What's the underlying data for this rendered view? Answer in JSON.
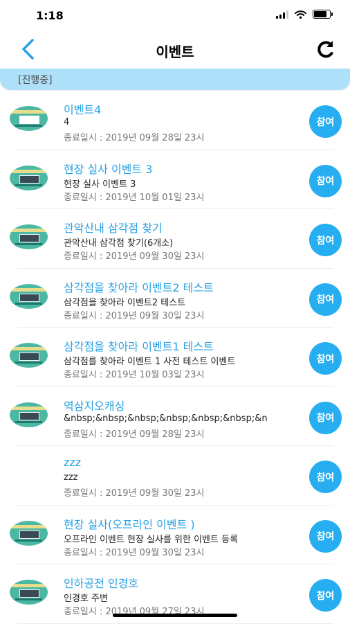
{
  "status_bar": {
    "time": "1:18"
  },
  "nav": {
    "title": "이벤트"
  },
  "section": {
    "label": "[진행중]"
  },
  "events": [
    {
      "title": "이벤트4",
      "desc": "4",
      "end": "종료일시 : 2019년 09월 28일 23시",
      "button": "참여",
      "thumb": "white"
    },
    {
      "title": "현장 실사 이벤트 3",
      "desc": "현장 실사 이벤트 3",
      "end": "종료일시 : 2019년 10월 01일 23시",
      "button": "참여",
      "thumb": "photo"
    },
    {
      "title": "관악산내 삼각점 찾기",
      "desc": "관악산내 삼각점 찾기(6개소)",
      "end": "종료일시 : 2019년 09월 30일 23시",
      "button": "참여",
      "thumb": "photo"
    },
    {
      "title": "삼각점을 찾아라 이벤트2 테스트",
      "desc": "삼각점을 찾아라 이벤트2 테스트",
      "end": "종료일시 : 2019년 09월 30일 23시",
      "button": "참여",
      "thumb": "photo"
    },
    {
      "title": "삼각점을 찾아라 이벤트1 테스트",
      "desc": "삼각점를 찾아라 이벤트 1 사전 테스트 이벤트",
      "end": "종료일시 : 2019년 10월 03일 23시",
      "button": "참여",
      "thumb": "photo"
    },
    {
      "title": "역삼지오캐싱",
      "desc": "&nbsp;&nbsp;&nbsp;&nbsp;&nbsp;&nbsp;&n",
      "end": "종료일시 : 2019년 09월 28일 23시",
      "button": "참여",
      "thumb": "photo"
    },
    {
      "title": "zzz",
      "desc": "zzz",
      "end": "종료일시 : 2019년 09월 30일 23시",
      "button": "참여",
      "thumb": "none"
    },
    {
      "title": "현장 실사(오프라인 이벤트 )",
      "desc": "오프라인 이벤트 현장 실사를 위한 이벤트 등록",
      "end": "종료일시 : 2019년 09월 30일 23시",
      "button": "참여",
      "thumb": "photo"
    },
    {
      "title": "인하공전 인경호",
      "desc": "인경호 주변",
      "end": "종료일시 : 2019년 09월 27일 23시",
      "button": "참여",
      "thumb": "photo"
    }
  ],
  "colors": {
    "accent": "#27a2e4",
    "button": "#26aef0",
    "section_bg": "#aee0f9"
  },
  "icons": {
    "back": "chevron-left-icon",
    "refresh": "refresh-icon",
    "signal": "signal-icon",
    "wifi": "wifi-icon",
    "battery": "battery-icon"
  }
}
